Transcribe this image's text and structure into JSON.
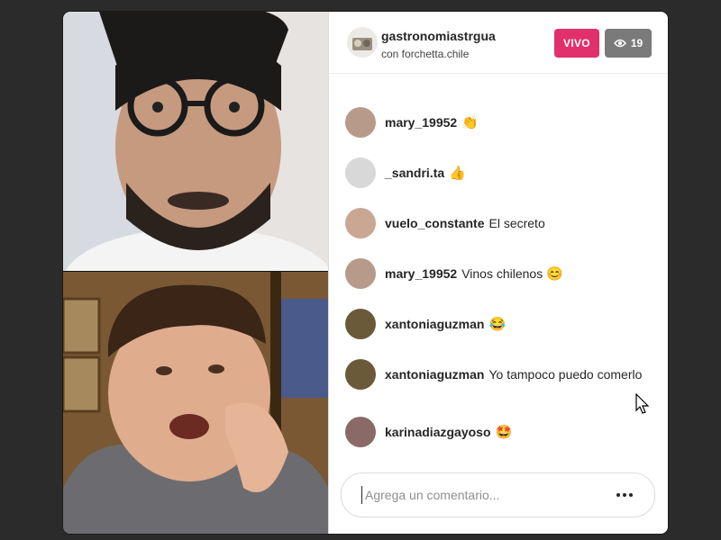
{
  "header": {
    "host_username": "gastronomiastrgua",
    "guest_line": "con forchetta.chile",
    "live_label": "VIVO",
    "viewer_count": "19",
    "viewer_icon": "eye-icon"
  },
  "comments": [
    {
      "user": "mary_19952",
      "text": "",
      "emoji": "👏",
      "avatar_color": "#b89a8a"
    },
    {
      "user": "_sandri.ta",
      "text": "",
      "emoji": "👍",
      "avatar_color": "#d8d8d8"
    },
    {
      "user": "vuelo_constante",
      "text": "El secreto",
      "emoji": "",
      "avatar_color": "#c9a792"
    },
    {
      "user": "mary_19952",
      "text": "Vinos chilenos",
      "emoji": "😊",
      "avatar_color": "#b89a8a"
    },
    {
      "user": "xantoniaguzman",
      "text": "",
      "emoji": "😂",
      "avatar_color": "#6b5a3a"
    },
    {
      "user": "xantoniaguzman",
      "text": "Yo tampoco puedo comerlo",
      "emoji": "",
      "avatar_color": "#6b5a3a"
    },
    {
      "user": "karinadiazgayoso",
      "text": "",
      "emoji": "🤩",
      "avatar_color": "#8a6a66"
    }
  ],
  "comment_input": {
    "placeholder": "Agrega un comentario...",
    "value": ""
  },
  "more_options_icon": "more-horizontal-icon",
  "colors": {
    "live_badge": "#e1306c",
    "viewer_badge": "#7a7a7a",
    "text": "#262626",
    "muted": "#8e8e8e"
  }
}
